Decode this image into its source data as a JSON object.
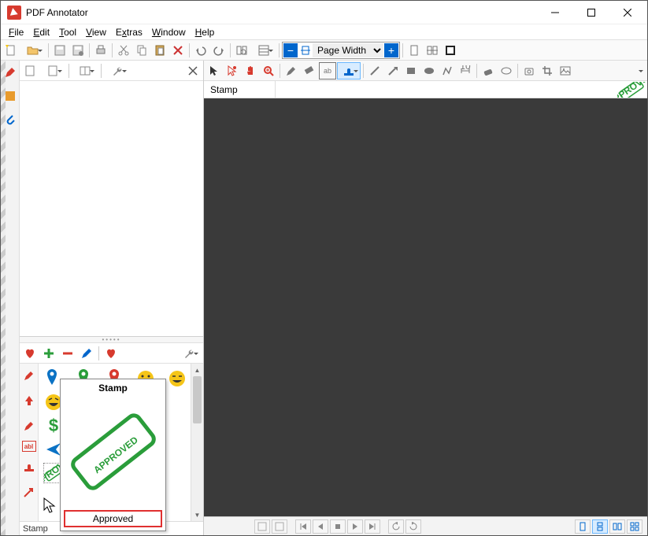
{
  "window": {
    "title": "PDF Annotator"
  },
  "menu": [
    "File",
    "Edit",
    "Tool",
    "View",
    "Extras",
    "Window",
    "Help"
  ],
  "zoom": {
    "selected": "Page Width"
  },
  "toolinfo": {
    "label": "Stamp"
  },
  "fav_status": "Stamp",
  "tooltip": {
    "title": "Stamp",
    "label": "Approved",
    "stamp_text": "APPROVED"
  },
  "preview_stamp": "APPROVED",
  "colors": {
    "accent": "#0066cc",
    "red": "#d73a2e",
    "green": "#2a9d3a",
    "orange": "#e89b2d"
  }
}
